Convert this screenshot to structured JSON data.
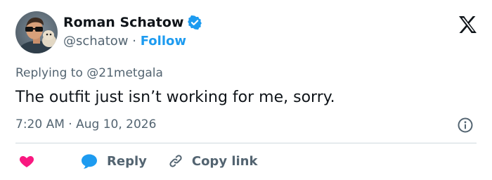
{
  "author": {
    "name": "Roman Schatow",
    "handle": "@schatow",
    "separator": "·",
    "follow_label": "Follow",
    "verified_icon": "verified-badge-icon",
    "avatar_icon": "avatar-photo"
  },
  "brand": {
    "logo_icon": "x-logo-icon"
  },
  "reply_context": {
    "prefix": "Replying to",
    "mention": "@21metgala"
  },
  "tweet": {
    "text": "The outfit just isn’t working for me, sorry.",
    "time": "7:20 AM",
    "separator": "·",
    "date": "Aug 10, 2026"
  },
  "actions": {
    "like_icon": "heart-icon",
    "reply_icon": "reply-bubble-icon",
    "reply_label": "Reply",
    "copy_icon": "link-icon",
    "copy_label": "Copy link",
    "info_icon": "info-icon"
  },
  "colors": {
    "accent": "#1d9bf0",
    "like": "#f91880",
    "text": "#0f1419",
    "secondary": "#536471",
    "divider": "#cfd9de"
  }
}
